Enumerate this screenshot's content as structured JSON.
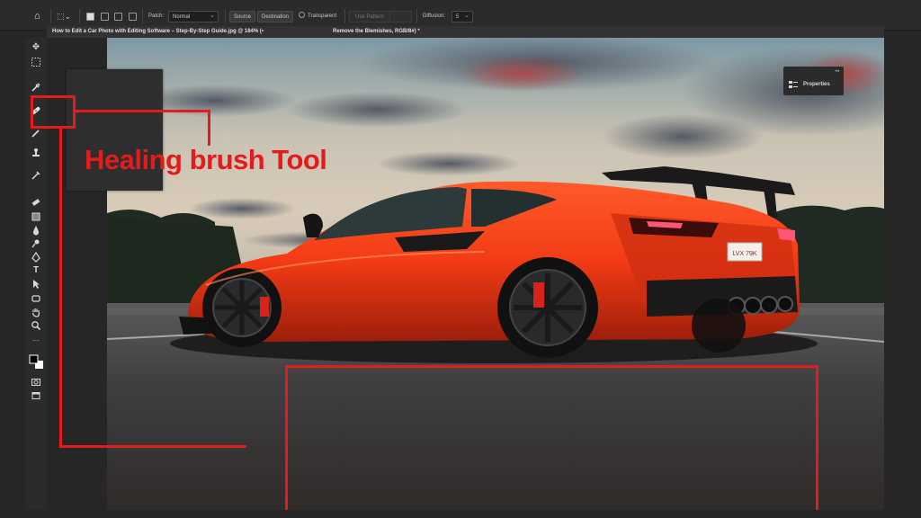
{
  "options_bar": {
    "patch_label": "Patch:",
    "patch_mode": "Normal",
    "source_label": "Source",
    "destination_label": "Destination",
    "transparent_label": "Transparent",
    "use_pattern_label": "Use Pattern",
    "diffusion_label": "Diffusion:",
    "diffusion_value": "5"
  },
  "document_tab": {
    "title": "How to Edit a Car Photo with Editing Software – Step-By-Step Guide.jpg @ 184% (•",
    "layer": "Remove the Blemishes, RGB/8#) *"
  },
  "toolbar": {
    "tools": [
      "move-tool",
      "marquee-tool",
      "eyedropper-tool",
      "healing-brush-tool",
      "brush-tool",
      "clone-stamp-tool",
      "history-brush-tool",
      "eraser-tool",
      "gradient-tool",
      "blur-tool",
      "dodge-tool",
      "pen-tool",
      "type-tool",
      "path-selection-tool",
      "shape-tool",
      "hand-tool",
      "zoom-tool",
      "more-tools",
      "color-swatches",
      "quick-mask",
      "screen-mode"
    ]
  },
  "properties_panel": {
    "title": "Properties"
  },
  "annotation": {
    "label": "Healing brush Tool",
    "color": "#e31b1b"
  },
  "car": {
    "plate": "LVX 79K"
  }
}
